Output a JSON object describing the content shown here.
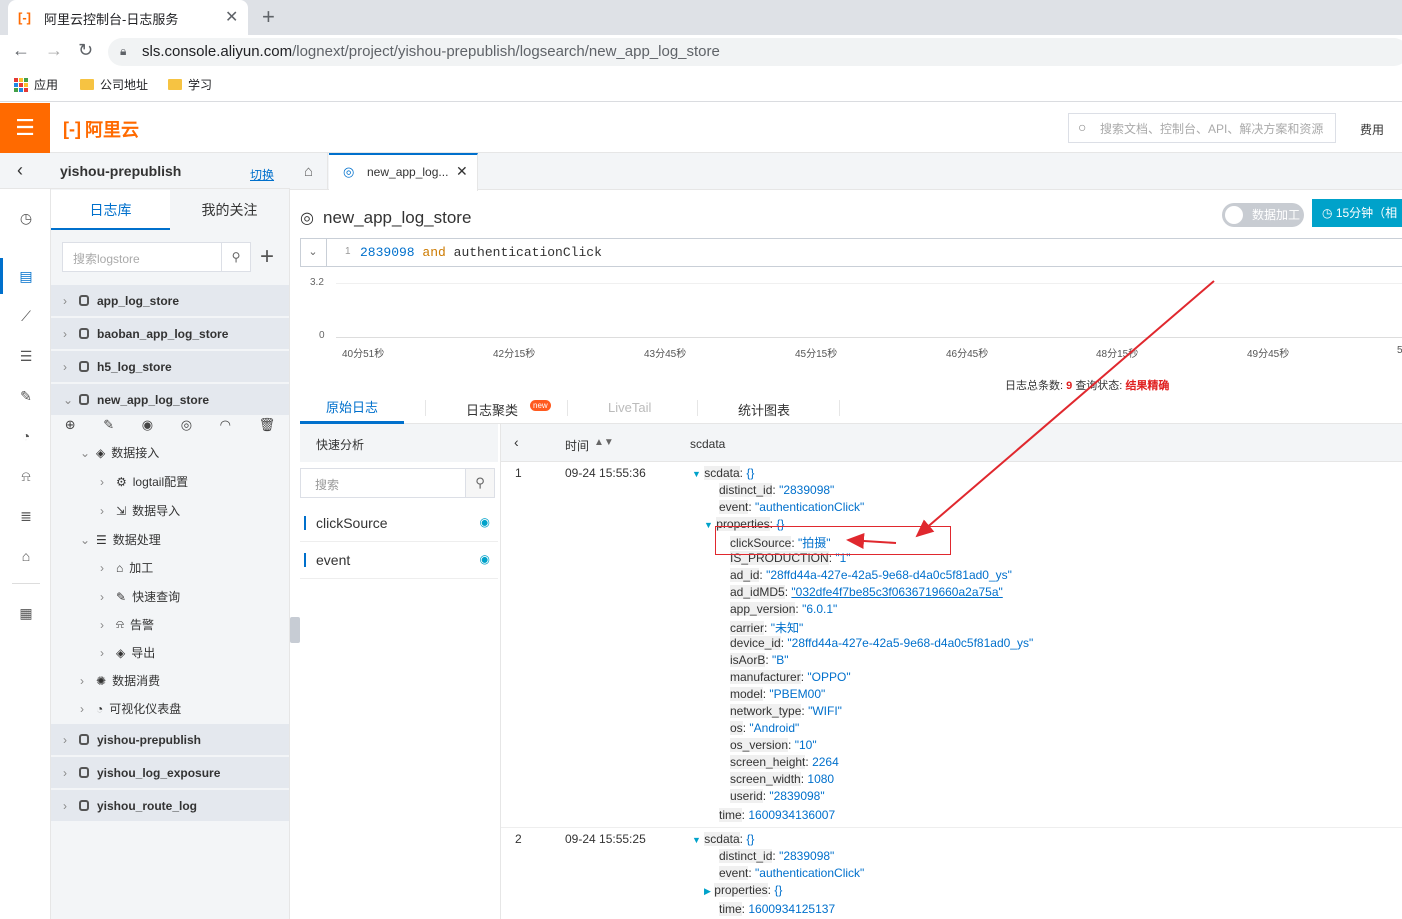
{
  "browser": {
    "tab_title": "阿里云控制台-日志服务",
    "url_host": "sls.console.aliyun.com",
    "url_path": "/lognext/project/yishou-prepublish/logsearch/new_app_log_store",
    "bookmarks": [
      "应用",
      "公司地址",
      "学习"
    ]
  },
  "header": {
    "logo_text": "阿里云",
    "search_placeholder": "搜索文档、控制台、API、解决方案和资源",
    "fee_label": "费用"
  },
  "sidebar": {
    "project": "yishou-prepublish",
    "switch_label": "切换",
    "tabs": [
      "日志库",
      "我的关注"
    ],
    "search_placeholder": "搜索logstore",
    "stores_top": [
      "app_log_store",
      "baoban_app_log_store",
      "h5_log_store",
      "new_app_log_store"
    ],
    "tree": {
      "data_ingest": "数据接入",
      "logtail": "logtail配置",
      "data_import": "数据导入",
      "data_process": "数据处理",
      "transform": "加工",
      "quick_query": "快速查询",
      "alert": "告警",
      "export": "导出",
      "consume": "数据消费",
      "dashboard": "可视化仪表盘"
    },
    "stores_bottom": [
      "yishou-prepublish",
      "yishou_log_exposure",
      "yishou_route_log"
    ]
  },
  "main": {
    "tab_label": "new_app_log...",
    "logstore_title": "new_app_log_store",
    "data_process_toggle": "数据加工",
    "time_button": "15分钟（相",
    "query": {
      "line_no": "1",
      "num": "2839098",
      "and": "and",
      "term": "authenticationClick"
    },
    "histogram": {
      "y_ticks": [
        "3.2",
        "0"
      ],
      "x_ticks": [
        "40分51秒",
        "42分15秒",
        "43分45秒",
        "45分15秒",
        "46分45秒",
        "48分15秒",
        "49分45秒",
        "5"
      ]
    },
    "summary": {
      "total_label": "日志总条数:",
      "total": "9",
      "status_label": "查询状态:",
      "status": "结果精确"
    },
    "result_tabs": [
      "原始日志",
      "日志聚类",
      "LiveTail",
      "统计图表"
    ],
    "new_badge": "new",
    "quick_analysis": {
      "title": "快速分析",
      "search_placeholder": "搜索",
      "fields": [
        "clickSource",
        "event"
      ]
    },
    "table": {
      "time_header": "时间",
      "data_header": "scdata"
    }
  },
  "logs": [
    {
      "index": "1",
      "time": "09-24 15:55:36",
      "scdata_key": "scdata",
      "distinct_id": "\"2839098\"",
      "event": "\"authenticationClick\"",
      "properties_key": "properties",
      "props": [
        {
          "k": "clickSource",
          "v": "\"拍摄\""
        },
        {
          "k": "IS_PRODUCTION",
          "v": "\"1\""
        },
        {
          "k": "ad_id",
          "v": "\"28ffd44a-427e-42a5-9e68-d4a0c5f81ad0_ys\""
        },
        {
          "k": "ad_idMD5",
          "v": "\"032dfe4f7be85c3f0636719660a2a75a\""
        },
        {
          "k": "app_version",
          "v": "\"6.0.1\""
        },
        {
          "k": "carrier",
          "v": "\"未知\""
        },
        {
          "k": "device_id",
          "v": "\"28ffd44a-427e-42a5-9e68-d4a0c5f81ad0_ys\""
        },
        {
          "k": "isAorB",
          "v": "\"B\""
        },
        {
          "k": "manufacturer",
          "v": "\"OPPO\""
        },
        {
          "k": "model",
          "v": "\"PBEM00\""
        },
        {
          "k": "network_type",
          "v": "\"WIFI\""
        },
        {
          "k": "os",
          "v": "\"Android\""
        },
        {
          "k": "os_version",
          "v": "\"10\""
        },
        {
          "k": "screen_height",
          "v": "2264"
        },
        {
          "k": "screen_width",
          "v": "1080"
        },
        {
          "k": "userid",
          "v": "\"2839098\""
        }
      ],
      "time_ts": "1600934136007"
    },
    {
      "index": "2",
      "time": "09-24 15:55:25",
      "scdata_key": "scdata",
      "distinct_id": "\"2839098\"",
      "event": "\"authenticationClick\"",
      "properties_key": "properties",
      "time_ts": "1600934125137"
    }
  ],
  "labels": {
    "distinct_id": "distinct_id",
    "event": "event",
    "time": "time",
    "braces": "{}",
    "colon": ":"
  },
  "colors": {
    "accent": "#0070cc",
    "brand": "#ff6a00",
    "annotation": "#e0282e"
  }
}
